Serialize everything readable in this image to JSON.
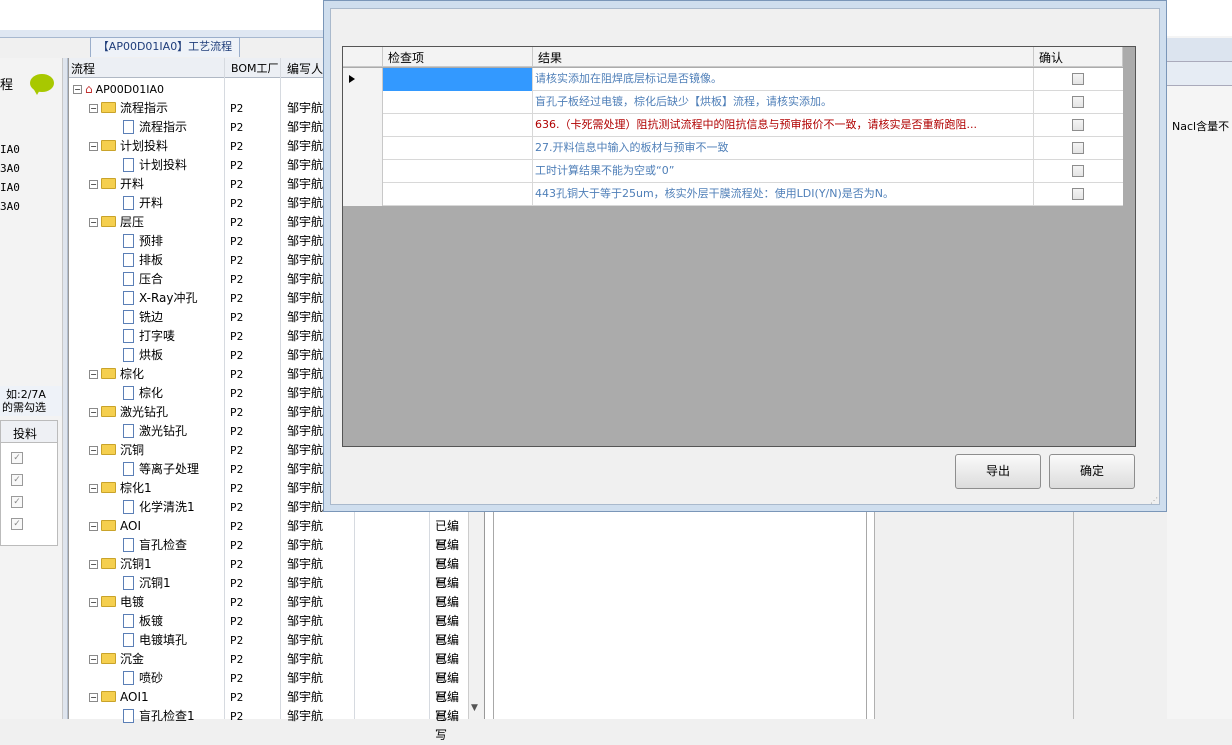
{
  "main_tab": {
    "title": "【AP00D01IA0】工艺流程"
  },
  "left_panel": {
    "title": "程",
    "codes": [
      "IA0",
      "3A0",
      "IA0",
      "3A0"
    ],
    "note_line1": "如:2/7A",
    "note_line2": "的需勾选",
    "grid_header": "投料"
  },
  "tree": {
    "headers": {
      "flow": "流程",
      "bom_plant": "BOM工厂",
      "author": "编写人"
    },
    "root": "AP00D01IA0",
    "rows": [
      {
        "label": "流程指示",
        "type": "folder",
        "plant": "P2",
        "author": "邹宇航",
        "status": ""
      },
      {
        "label": "流程指示",
        "type": "doc",
        "plant": "P2",
        "author": "邹宇航",
        "status": ""
      },
      {
        "label": "计划投料",
        "type": "folder",
        "plant": "P2",
        "author": "邹宇航",
        "status": ""
      },
      {
        "label": "计划投料",
        "type": "doc",
        "plant": "P2",
        "author": "邹宇航",
        "status": ""
      },
      {
        "label": "开料",
        "type": "folder",
        "plant": "P2",
        "author": "邹宇航",
        "status": ""
      },
      {
        "label": "开料",
        "type": "doc",
        "plant": "P2",
        "author": "邹宇航",
        "status": ""
      },
      {
        "label": "层压",
        "type": "folder",
        "plant": "P2",
        "author": "邹宇航",
        "status": ""
      },
      {
        "label": "预排",
        "type": "doc",
        "plant": "P2",
        "author": "邹宇航",
        "status": ""
      },
      {
        "label": "排板",
        "type": "doc",
        "plant": "P2",
        "author": "邹宇航",
        "status": ""
      },
      {
        "label": "压合",
        "type": "doc",
        "plant": "P2",
        "author": "邹宇航",
        "status": ""
      },
      {
        "label": "X-Ray冲孔",
        "type": "doc",
        "plant": "P2",
        "author": "邹宇航",
        "status": ""
      },
      {
        "label": "铣边",
        "type": "doc",
        "plant": "P2",
        "author": "邹宇航",
        "status": ""
      },
      {
        "label": "打字唛",
        "type": "doc",
        "plant": "P2",
        "author": "邹宇航",
        "status": ""
      },
      {
        "label": "烘板",
        "type": "doc",
        "plant": "P2",
        "author": "邹宇航",
        "status": ""
      },
      {
        "label": "棕化",
        "type": "folder",
        "plant": "P2",
        "author": "邹宇航",
        "status": ""
      },
      {
        "label": "棕化",
        "type": "doc",
        "plant": "P2",
        "author": "邹宇航",
        "status": ""
      },
      {
        "label": "激光钻孔",
        "type": "folder",
        "plant": "P2",
        "author": "邹宇航",
        "status": ""
      },
      {
        "label": "激光钻孔",
        "type": "doc",
        "plant": "P2",
        "author": "邹宇航",
        "status": ""
      },
      {
        "label": "沉铜",
        "type": "folder",
        "plant": "P2",
        "author": "邹宇航",
        "status": ""
      },
      {
        "label": "等离子处理",
        "type": "doc",
        "plant": "P2",
        "author": "邹宇航",
        "status": ""
      },
      {
        "label": "棕化1",
        "type": "folder",
        "plant": "P2",
        "author": "邹宇航",
        "status": ""
      },
      {
        "label": "化学清洗1",
        "type": "doc",
        "plant": "P2",
        "author": "邹宇航",
        "status": ""
      },
      {
        "label": "AOI",
        "type": "folder",
        "plant": "P2",
        "author": "邹宇航",
        "status": "已编写"
      },
      {
        "label": "盲孔检查",
        "type": "doc",
        "plant": "P2",
        "author": "邹宇航",
        "status": "已编写"
      },
      {
        "label": "沉铜1",
        "type": "folder",
        "plant": "P2",
        "author": "邹宇航",
        "status": "已编写"
      },
      {
        "label": "沉铜1",
        "type": "doc",
        "plant": "P2",
        "author": "邹宇航",
        "status": "已编写"
      },
      {
        "label": "电镀",
        "type": "folder",
        "plant": "P2",
        "author": "邹宇航",
        "status": "已编写"
      },
      {
        "label": "板镀",
        "type": "doc",
        "plant": "P2",
        "author": "邹宇航",
        "status": "已编写"
      },
      {
        "label": "电镀填孔",
        "type": "doc",
        "plant": "P2",
        "author": "邹宇航",
        "status": "已编写"
      },
      {
        "label": "沉金",
        "type": "folder",
        "plant": "P2",
        "author": "邹宇航",
        "status": "已编写"
      },
      {
        "label": "喷砂",
        "type": "doc",
        "plant": "P2",
        "author": "邹宇航",
        "status": "已编写"
      },
      {
        "label": "AOI1",
        "type": "folder",
        "plant": "P2",
        "author": "邹宇航",
        "status": "已编写"
      },
      {
        "label": "盲孔检查1",
        "type": "doc",
        "plant": "P2",
        "author": "邹宇航",
        "status": "已编写"
      }
    ]
  },
  "right_panel": {
    "text": "Nacl含量不"
  },
  "dialog": {
    "headers": {
      "check_item": "检查项",
      "result": "结果",
      "confirm": "确认"
    },
    "rows": [
      {
        "check_item": "",
        "result": "请核实添加在阻焊底层标记是否镜像。",
        "color": "#4f7fb8",
        "checked": false
      },
      {
        "check_item": "",
        "result": "盲孔子板经过电镀，棕化后缺少【烘板】流程，请核实添加。",
        "color": "#4f7fb8",
        "checked": false
      },
      {
        "check_item": "",
        "result": "636.（卡死需处理）阻抗测试流程中的阻抗信息与预审报价不一致，请核实是否重新跑阻...",
        "color": "#b00000",
        "checked": false
      },
      {
        "check_item": "",
        "result": "27.开料信息中输入的板材与预审不一致",
        "color": "#4f7fb8",
        "checked": false
      },
      {
        "check_item": "",
        "result": "工时计算结果不能为空或“0”",
        "color": "#4f7fb8",
        "checked": false
      },
      {
        "check_item": "",
        "result": "443孔铜大于等于25um，核实外层干膜流程处：使用LDI(Y/N)是否为N。",
        "color": "#4f7fb8",
        "checked": false
      }
    ],
    "export_label": "导出",
    "ok_label": "确定"
  }
}
